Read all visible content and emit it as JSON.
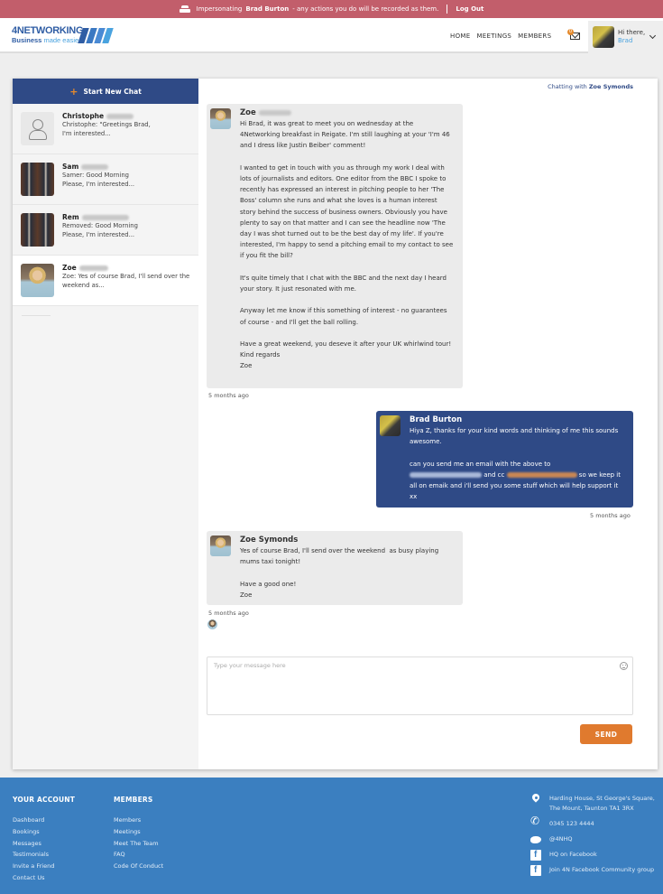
{
  "impersonation": {
    "prefix": "Impersonating",
    "user": "Brad Burton",
    "suffix": "- any actions you do will be recorded as them.",
    "logout": "Log Out"
  },
  "header": {
    "logo_top": "4NETWORKING",
    "logo_bottom_a": "Business",
    "logo_bottom_b": "made easier.",
    "nav": [
      "HOME",
      "MEETINGS",
      "MEMBERS"
    ],
    "mail_badge": "0",
    "greeting": "Hi there,",
    "user_name": "Brad"
  },
  "sidebar": {
    "new_chat": "Start New Chat",
    "conversations": [
      {
        "name": "Christophe",
        "preview": "Christophe: \"Greetings Brad,\nI'm interested...",
        "avatar": "placeholder",
        "active": false
      },
      {
        "name": "Sam",
        "preview": "Samer: Good Morning\nPlease, I'm interested...",
        "avatar": "photo",
        "active": false
      },
      {
        "name": "Rem",
        "preview": "Removed: Good Morning\nPlease, I'm interested...",
        "avatar": "photo",
        "active": false
      },
      {
        "name": "Zoe",
        "preview": "Zoe: Yes of course Brad, I'll send over the\nweekend  as...",
        "avatar": "photo",
        "active": true
      }
    ]
  },
  "chat": {
    "chatting_prefix": "Chatting with",
    "chatting_name": "Zoe Symonds",
    "messages": [
      {
        "sender": "Zoe",
        "direction": "incoming",
        "body": "Hi Brad, it was great to meet you on wednesday at the 4Networking breakfast in Reigate. I'm still laughing at your 'I'm 46 and I dress like Justin Beiber' comment!\n\nI wanted to get in touch with you as through my work I deal with lots of journalists and editors. One editor from the BBC I spoke to recently has expressed an interest in pitching people to her 'The Boss' column she runs and what she loves is a human interest story behind the success of business owners. Obviously you have plenty to say on that matter and I can see the headline now 'The day I was shot turned out to be the best day of my life'. If you're interested, I'm happy to send a pitching email to my contact to see if you fit the bill?\n\nIt's quite timely that I chat with the BBC and the next day I heard your story. It just resonated with me.\n\nAnyway let me know if this something of interest - no guarantees of course - and I'll get the ball rolling.\n\nHave a great weekend, you deseve it after your UK whirlwind tour!\nKind regards\nZoe",
        "time": "5 months ago"
      },
      {
        "sender": "Brad Burton",
        "direction": "outgoing",
        "body_a": "Hiya Z, thanks for your kind words and thinking of me this sounds awesome.\n\ncan you send me an email with the above to",
        "body_b": "and cc",
        "body_c": "so we keep it all on emaik and i'll send you some stuff which will help support it xx",
        "time": "5 months ago"
      },
      {
        "sender": "Zoe Symonds",
        "direction": "incoming",
        "body": "Yes of course Brad, I'll send over the weekend  as busy playing mums taxi tonight!\n\nHave a good one!\nZoe",
        "time": "5 months ago"
      }
    ],
    "input_placeholder": "Type your message here",
    "send_label": "SEND"
  },
  "footer": {
    "col1": {
      "title": "YOUR ACCOUNT",
      "links": [
        "Dashboard",
        "Bookings",
        "Messages",
        "Testimonials",
        "Invite a Friend",
        "Contact Us"
      ]
    },
    "col2": {
      "title": "MEMBERS",
      "links": [
        "Members",
        "Meetings",
        "Meet The Team",
        "FAQ",
        "Code Of Conduct"
      ]
    },
    "contact": {
      "address": "Harding House, St George's Square,\nThe Mount, Taunton TA1 3RX",
      "phone": "0345 123 4444",
      "twitter": "@4NHQ",
      "facebook": "HQ on Facebook",
      "community": "Join 4N Facebook Community group"
    }
  }
}
